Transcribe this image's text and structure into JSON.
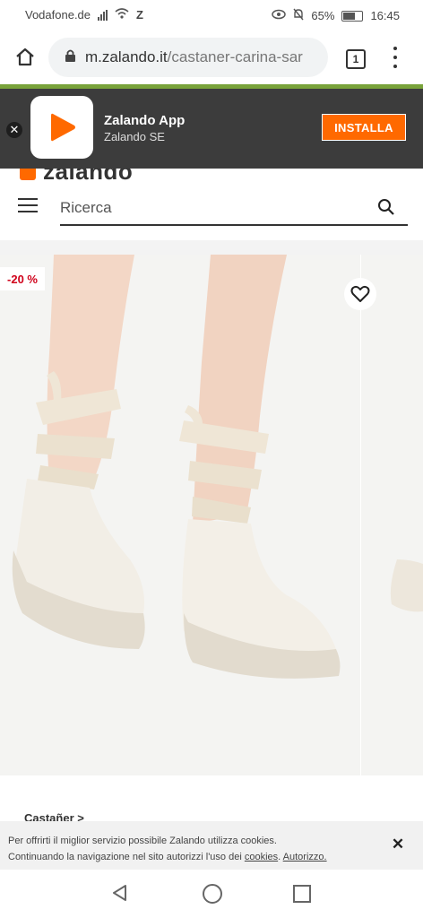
{
  "status_bar": {
    "carrier": "Vodafone.de",
    "battery": "65%",
    "time": "16:45"
  },
  "browser": {
    "url_host": "m.zalando.it",
    "url_path": "/castaner-carina-sar",
    "tab_count": "1"
  },
  "app_banner": {
    "title": "Zalando App",
    "publisher": "Zalando SE",
    "install_label": "INSTALLA"
  },
  "header": {
    "logo_text": "zalando",
    "search_placeholder": "Ricerca"
  },
  "product": {
    "discount_badge": "-20 %",
    "brand_link": "Castañer >"
  },
  "cookie_bar": {
    "text_line1": "Per offrirti il miglior servizio possibile Zalando utilizza cookies.",
    "text_line2": "Continuando la navigazione nel sito autorizzi l'uso dei",
    "cookies_link": "cookies",
    "authorize_link": "Autorizzo.",
    "close_label": "✕"
  },
  "colors": {
    "accent": "#ff6900",
    "green_line": "#79a33a",
    "banner_bg": "#3c3c3c",
    "discount": "#d0021b"
  }
}
